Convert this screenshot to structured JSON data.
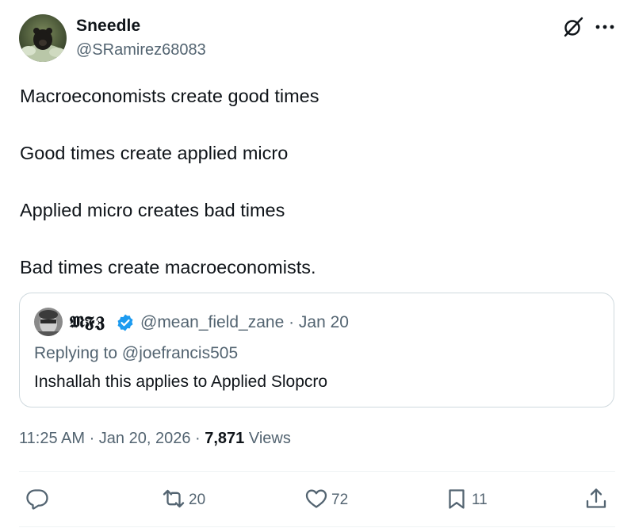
{
  "author": {
    "display_name": "Sneedle",
    "handle": "@SRamirez68083"
  },
  "header_icons": [
    "grok-icon",
    "more-icon"
  ],
  "tweet": {
    "lines": [
      "Macroeconomists create good times",
      "Good times create applied micro",
      "Applied micro creates bad times",
      "Bad times create macroeconomists."
    ]
  },
  "quote": {
    "display_name": "𝕸𝕱𝖅",
    "verified": true,
    "meta": "@mean_field_zane · Jan 20",
    "replying_prefix": "Replying to ",
    "replying_to": "@joefrancis505",
    "text": "Inshallah this applies to Applied Slopcro"
  },
  "timestamp": {
    "time_date": "11:25 AM · Jan 20, 2026 · ",
    "views_count": "7,871",
    "views_label": " Views"
  },
  "actions": {
    "reply_count": "",
    "retweet_count": "20",
    "like_count": "72",
    "bookmark_count": "11"
  },
  "colors": {
    "text": "#0f1419",
    "secondary": "#536471",
    "border": "#cfd9de",
    "verified": "#1d9bf0"
  }
}
